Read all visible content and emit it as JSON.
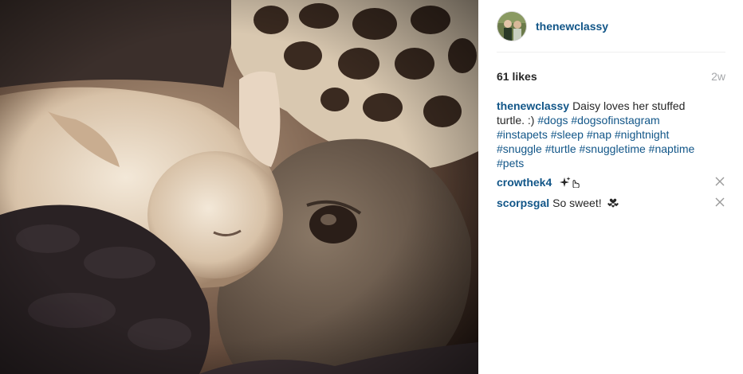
{
  "post": {
    "username": "thenewclassy",
    "likes_text": "61 likes",
    "time_ago": "2w"
  },
  "caption": {
    "author": "thenewclassy",
    "text": "Daisy loves her stuffed turtle. :)",
    "hashtags": "#dogs #dogsofinstagram #instapets #sleep #nap #nightnight #snuggle #turtle #snuggletime #naptime #pets"
  },
  "comments": [
    {
      "author": "crowthek4",
      "text": "",
      "emoji": "sparkles-hand-icon"
    },
    {
      "author": "scorpsgal",
      "text": "So sweet!",
      "emoji": "hearts-icon"
    }
  ],
  "colors": {
    "link": "#125688",
    "text": "#262626",
    "muted": "#a5a7aa",
    "divider": "#efefef"
  }
}
